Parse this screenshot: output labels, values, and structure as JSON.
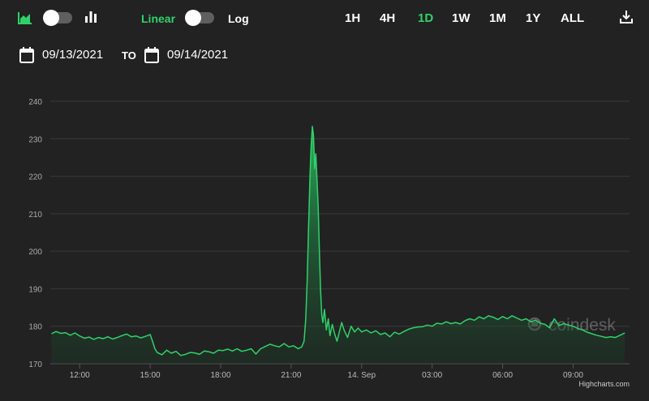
{
  "toolbar": {
    "linear_label": "Linear",
    "log_label": "Log",
    "ranges": [
      "1H",
      "4H",
      "1D",
      "1W",
      "1M",
      "1Y",
      "ALL"
    ],
    "active_range": "1D",
    "accent_color": "#2fd26a",
    "icons": [
      "area-chart-icon",
      "candlestick-icon",
      "download-icon"
    ]
  },
  "date_range": {
    "from": "09/13/2021",
    "to_label": "TO",
    "to": "09/14/2021"
  },
  "watermark": "coindesk",
  "credits": "Highcharts.com",
  "chart_data": {
    "type": "area",
    "title": "",
    "xlabel": "",
    "ylabel": "",
    "ylim": [
      170,
      240
    ],
    "yticks": [
      170,
      180,
      190,
      200,
      210,
      220,
      230,
      240
    ],
    "grid": true,
    "x_unit": "hours",
    "xlim": [
      10.75,
      35.4
    ],
    "xtick_labels": [
      {
        "x": 12,
        "label": "12:00"
      },
      {
        "x": 15,
        "label": "15:00"
      },
      {
        "x": 18,
        "label": "18:00"
      },
      {
        "x": 21,
        "label": "21:00"
      },
      {
        "x": 24,
        "label": "14. Sep"
      },
      {
        "x": 27,
        "label": "03:00"
      },
      {
        "x": 30,
        "label": "06:00"
      },
      {
        "x": 33,
        "label": "09:00"
      }
    ],
    "series": [
      {
        "color": "#2fd26a",
        "points": [
          [
            10.8,
            178.0
          ],
          [
            11.0,
            178.6
          ],
          [
            11.2,
            178.1
          ],
          [
            11.4,
            178.3
          ],
          [
            11.6,
            177.6
          ],
          [
            11.8,
            178.2
          ],
          [
            12.0,
            177.4
          ],
          [
            12.2,
            176.8
          ],
          [
            12.4,
            177.1
          ],
          [
            12.6,
            176.5
          ],
          [
            12.8,
            177.0
          ],
          [
            13.0,
            176.7
          ],
          [
            13.2,
            177.2
          ],
          [
            13.4,
            176.6
          ],
          [
            13.6,
            177.0
          ],
          [
            13.8,
            177.5
          ],
          [
            14.0,
            177.9
          ],
          [
            14.2,
            177.2
          ],
          [
            14.4,
            177.4
          ],
          [
            14.6,
            176.9
          ],
          [
            14.8,
            177.3
          ],
          [
            15.0,
            177.8
          ],
          [
            15.1,
            176.0
          ],
          [
            15.2,
            174.0
          ],
          [
            15.3,
            173.0
          ],
          [
            15.5,
            172.4
          ],
          [
            15.7,
            173.6
          ],
          [
            15.9,
            172.8
          ],
          [
            16.1,
            173.3
          ],
          [
            16.3,
            172.2
          ],
          [
            16.5,
            172.5
          ],
          [
            16.7,
            173.0
          ],
          [
            16.9,
            172.9
          ],
          [
            17.1,
            172.5
          ],
          [
            17.3,
            173.4
          ],
          [
            17.5,
            173.2
          ],
          [
            17.7,
            172.8
          ],
          [
            17.9,
            173.6
          ],
          [
            18.1,
            173.5
          ],
          [
            18.3,
            173.9
          ],
          [
            18.5,
            173.4
          ],
          [
            18.7,
            174.0
          ],
          [
            18.9,
            173.3
          ],
          [
            19.1,
            173.6
          ],
          [
            19.3,
            174.0
          ],
          [
            19.5,
            172.6
          ],
          [
            19.7,
            174.0
          ],
          [
            19.9,
            174.6
          ],
          [
            20.1,
            175.2
          ],
          [
            20.3,
            174.8
          ],
          [
            20.5,
            174.5
          ],
          [
            20.7,
            175.4
          ],
          [
            20.9,
            174.5
          ],
          [
            21.1,
            174.8
          ],
          [
            21.3,
            174.0
          ],
          [
            21.45,
            174.5
          ],
          [
            21.55,
            176.0
          ],
          [
            21.62,
            182.0
          ],
          [
            21.68,
            192.0
          ],
          [
            21.74,
            206.0
          ],
          [
            21.8,
            220.0
          ],
          [
            21.85,
            228.0
          ],
          [
            21.9,
            233.3
          ],
          [
            21.95,
            231.0
          ],
          [
            22.0,
            222.0
          ],
          [
            22.05,
            226.0
          ],
          [
            22.1,
            219.0
          ],
          [
            22.15,
            212.0
          ],
          [
            22.2,
            200.0
          ],
          [
            22.25,
            190.0
          ],
          [
            22.3,
            183.0
          ],
          [
            22.35,
            181.0
          ],
          [
            22.42,
            184.5
          ],
          [
            22.5,
            179.0
          ],
          [
            22.58,
            182.0
          ],
          [
            22.65,
            177.5
          ],
          [
            22.75,
            180.5
          ],
          [
            22.85,
            178.0
          ],
          [
            22.95,
            176.0
          ],
          [
            23.05,
            178.5
          ],
          [
            23.15,
            181.0
          ],
          [
            23.25,
            179.0
          ],
          [
            23.4,
            177.0
          ],
          [
            23.55,
            180.0
          ],
          [
            23.7,
            178.5
          ],
          [
            23.85,
            179.5
          ],
          [
            24.0,
            178.5
          ],
          [
            24.2,
            179.0
          ],
          [
            24.4,
            178.2
          ],
          [
            24.6,
            178.8
          ],
          [
            24.8,
            177.8
          ],
          [
            25.0,
            178.2
          ],
          [
            25.2,
            177.2
          ],
          [
            25.4,
            178.4
          ],
          [
            25.6,
            177.9
          ],
          [
            25.8,
            178.6
          ],
          [
            26.0,
            179.2
          ],
          [
            26.2,
            179.6
          ],
          [
            26.4,
            179.8
          ],
          [
            26.6,
            179.9
          ],
          [
            26.8,
            180.3
          ],
          [
            27.0,
            180.0
          ],
          [
            27.2,
            180.8
          ],
          [
            27.4,
            180.6
          ],
          [
            27.6,
            181.2
          ],
          [
            27.8,
            180.7
          ],
          [
            28.0,
            181.0
          ],
          [
            28.2,
            180.6
          ],
          [
            28.4,
            181.5
          ],
          [
            28.6,
            182.0
          ],
          [
            28.8,
            181.6
          ],
          [
            29.0,
            182.5
          ],
          [
            29.2,
            182.0
          ],
          [
            29.4,
            182.8
          ],
          [
            29.6,
            182.4
          ],
          [
            29.8,
            181.8
          ],
          [
            30.0,
            182.6
          ],
          [
            30.2,
            182.0
          ],
          [
            30.4,
            182.8
          ],
          [
            30.6,
            182.2
          ],
          [
            30.8,
            181.6
          ],
          [
            31.0,
            182.0
          ],
          [
            31.2,
            181.2
          ],
          [
            31.4,
            181.6
          ],
          [
            31.6,
            180.8
          ],
          [
            31.8,
            180.5
          ],
          [
            32.0,
            179.6
          ],
          [
            32.2,
            182.0
          ],
          [
            32.4,
            180.2
          ],
          [
            32.6,
            180.7
          ],
          [
            32.8,
            180.3
          ],
          [
            33.0,
            180.0
          ],
          [
            33.2,
            179.4
          ],
          [
            33.4,
            179.0
          ],
          [
            33.6,
            178.4
          ],
          [
            33.8,
            178.0
          ],
          [
            34.0,
            177.6
          ],
          [
            34.2,
            177.3
          ],
          [
            34.4,
            177.0
          ],
          [
            34.6,
            177.2
          ],
          [
            34.8,
            177.0
          ],
          [
            35.0,
            177.6
          ],
          [
            35.2,
            178.2
          ]
        ]
      }
    ]
  }
}
